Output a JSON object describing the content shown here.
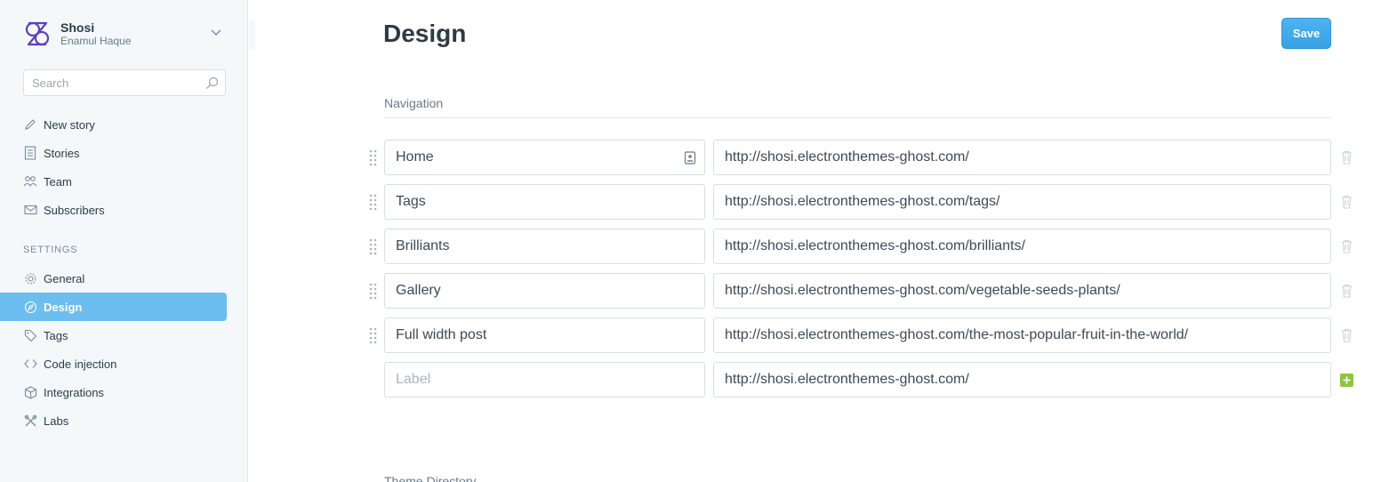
{
  "brand": {
    "name": "Shosi",
    "user": "Enamul Haque"
  },
  "search": {
    "placeholder": "Search"
  },
  "nav_main": [
    {
      "label": "New story",
      "icon": "pencil-icon"
    },
    {
      "label": "Stories",
      "icon": "document-list-icon"
    },
    {
      "label": "Team",
      "icon": "team-icon"
    },
    {
      "label": "Subscribers",
      "icon": "mail-icon"
    }
  ],
  "settings_heading": "SETTINGS",
  "nav_settings": [
    {
      "label": "General",
      "icon": "gear-icon",
      "active": false
    },
    {
      "label": "Design",
      "icon": "compass-icon",
      "active": true
    },
    {
      "label": "Tags",
      "icon": "tag-icon",
      "active": false
    },
    {
      "label": "Code injection",
      "icon": "code-icon",
      "active": false
    },
    {
      "label": "Integrations",
      "icon": "cube-icon",
      "active": false
    },
    {
      "label": "Labs",
      "icon": "tools-icon",
      "active": false
    }
  ],
  "page": {
    "title": "Design",
    "save_label": "Save"
  },
  "navigation": {
    "heading": "Navigation",
    "items": [
      {
        "label": "Home",
        "url": "http://shosi.electronthemes-ghost.com/"
      },
      {
        "label": "Tags",
        "url": "http://shosi.electronthemes-ghost.com/tags/"
      },
      {
        "label": "Brilliants",
        "url": "http://shosi.electronthemes-ghost.com/brilliants/"
      },
      {
        "label": "Gallery",
        "url": "http://shosi.electronthemes-ghost.com/vegetable-seeds-plants/"
      },
      {
        "label": "Full width post",
        "url": "http://shosi.electronthemes-ghost.com/the-most-popular-fruit-in-the-world/"
      }
    ],
    "new_item": {
      "label_placeholder": "Label",
      "url": "http://shosi.electronthemes-ghost.com/"
    }
  },
  "next_section": "Theme Directory",
  "colors": {
    "accent": "#6cbdf0",
    "save": "#3ca6e8",
    "add": "#8fc43f",
    "brand": "#5b3fc4"
  }
}
